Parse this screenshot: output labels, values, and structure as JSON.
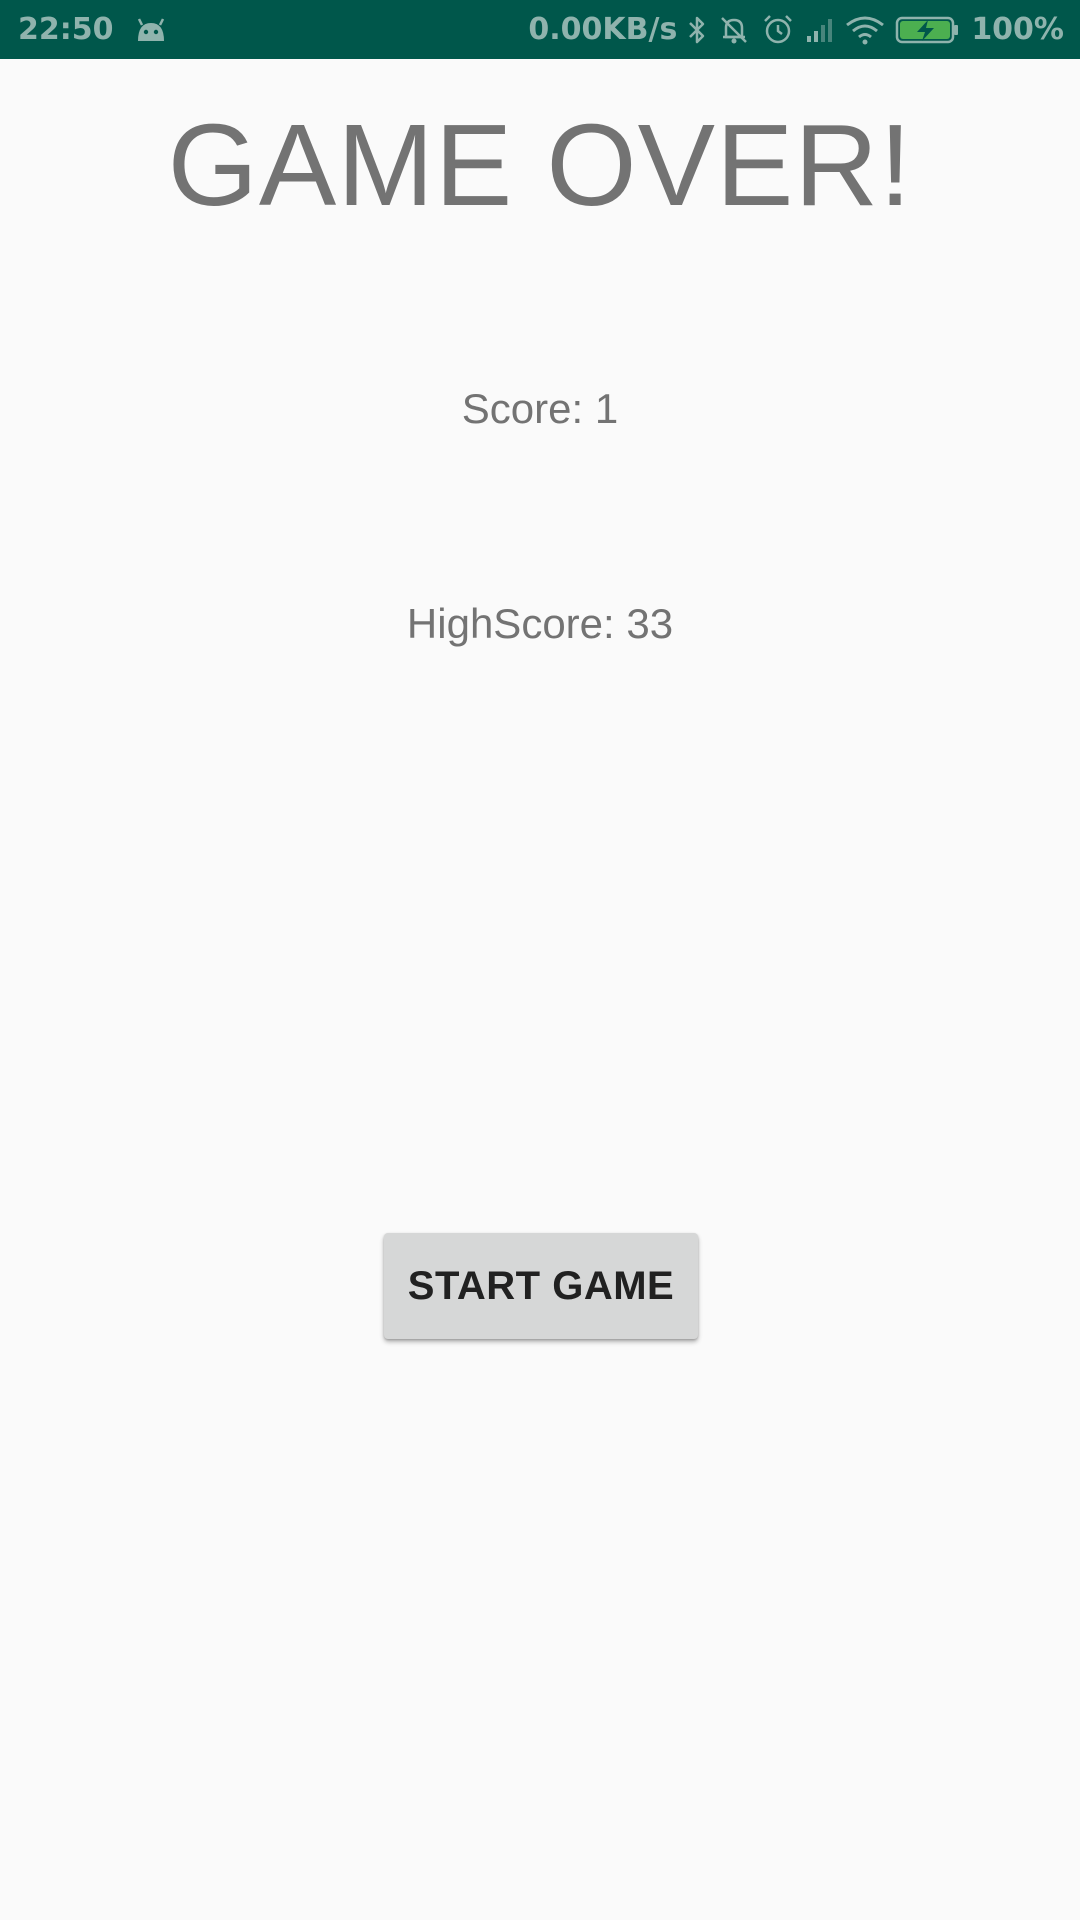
{
  "status_bar": {
    "time": "22:50",
    "network_speed": "0.00KB/s",
    "battery_percent": "100%",
    "background_color": "#00574b",
    "icons": [
      "android-debug-icon",
      "bluetooth-icon",
      "notifications-off-icon",
      "alarm-icon",
      "cell-signal-icon",
      "wifi-icon",
      "battery-charging-icon"
    ]
  },
  "screen": {
    "title": "GAME OVER!",
    "score_text": "Score: 1",
    "highscore_text": "HighScore: 33",
    "start_button_label": "START GAME"
  },
  "colors": {
    "background": "#fafafa",
    "text_gray": "#737373",
    "button_bg": "#d6d7d7",
    "button_text": "#212121",
    "battery_green": "#4caf50"
  }
}
